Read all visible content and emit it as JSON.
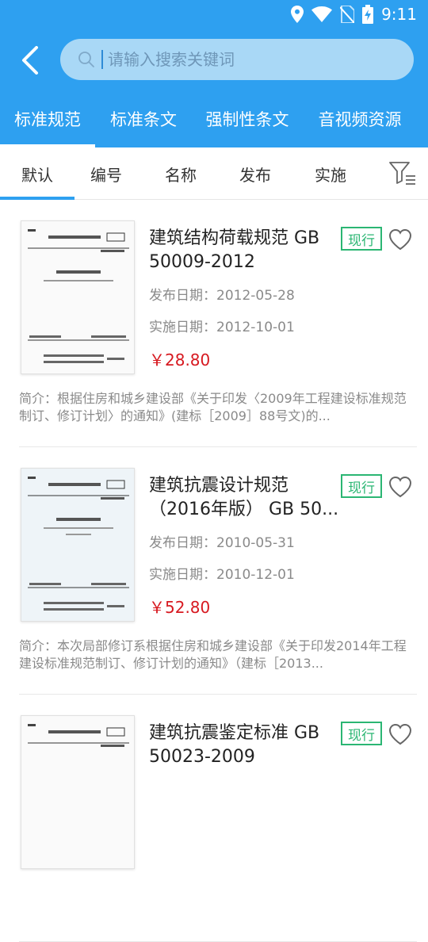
{
  "status": {
    "time": "9:11"
  },
  "search": {
    "placeholder": "请输入搜索关键词"
  },
  "category_tabs": [
    {
      "label": "标准规范",
      "active": true
    },
    {
      "label": "标准条文",
      "active": false
    },
    {
      "label": "强制性条文",
      "active": false
    },
    {
      "label": "音视频资源",
      "active": false
    }
  ],
  "sort_tabs": [
    {
      "label": "默认",
      "active": true
    },
    {
      "label": "编号"
    },
    {
      "label": "名称"
    },
    {
      "label": "发布"
    },
    {
      "label": "实施"
    }
  ],
  "items": [
    {
      "title": "建筑结构荷载规范 GB 50009-2012",
      "status": "现行",
      "publish": "发布日期：2012-05-28",
      "implement": "实施日期：2012-10-01",
      "price": "￥28.80",
      "summary": "简介：根据住房和城乡建设部《关于印发〈2009年工程建设标准规范制订、修订计划〉的通知》(建标［2009］88号文)的..."
    },
    {
      "title": "建筑抗震设计规范（2016年版） GB 50...",
      "status": "现行",
      "publish": "发布日期：2010-05-31",
      "implement": "实施日期：2010-12-01",
      "price": "￥52.80",
      "summary": "简介：本次局部修订系根据住房和城乡建设部《关于印发2014年工程建设标准规范制订、修订计划的通知》（建标［2013..."
    },
    {
      "title": "建筑抗震鉴定标准 GB 50023-2009",
      "status": "现行",
      "publish": "",
      "implement": "",
      "price": "",
      "summary": ""
    }
  ],
  "colors": {
    "primary": "#2ea0f0",
    "badge": "#2bb673",
    "price": "#d71920"
  }
}
